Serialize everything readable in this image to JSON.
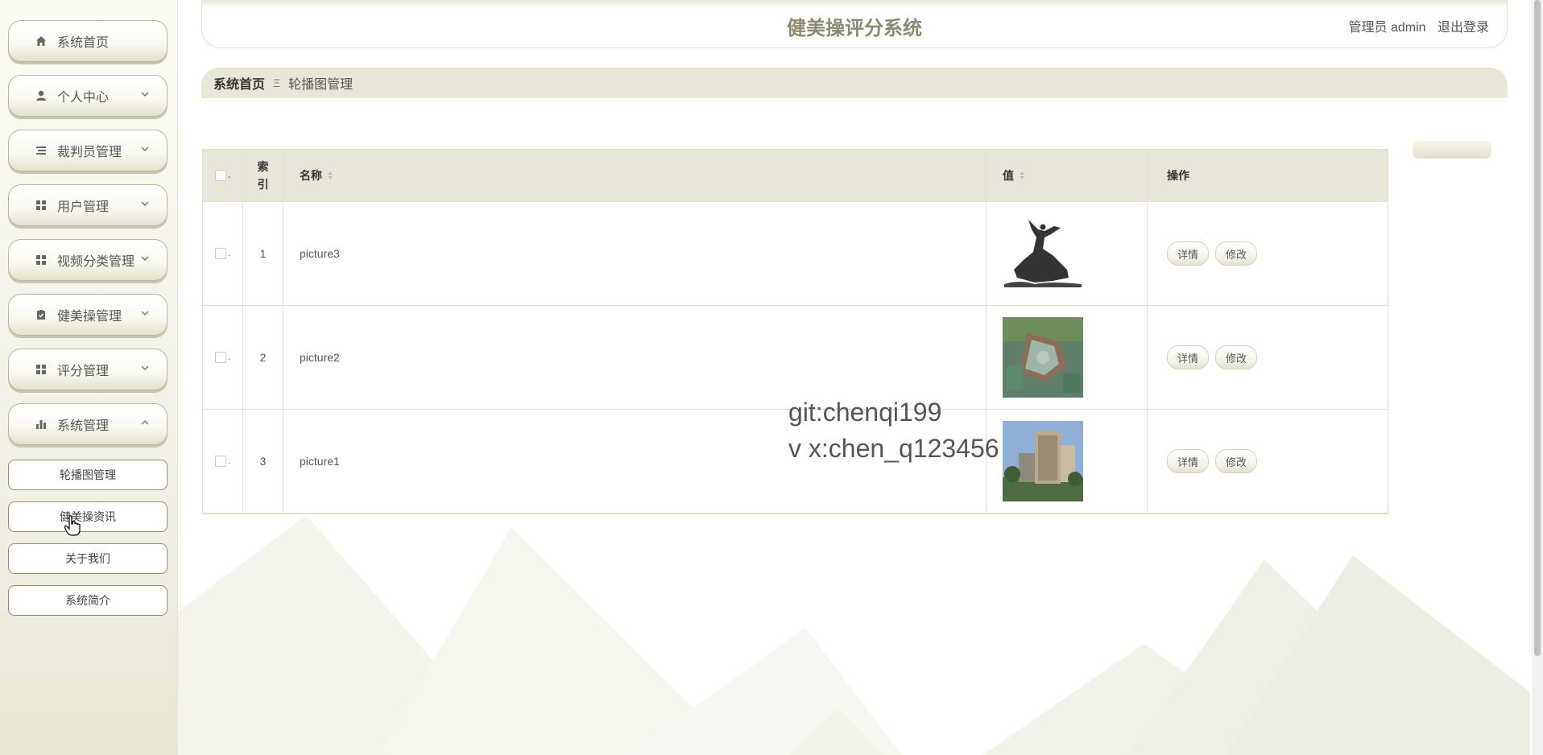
{
  "header": {
    "title": "健美操评分系统",
    "role": "管理员 admin",
    "logout": "退出登录"
  },
  "sidebar": {
    "items": [
      {
        "label": "系统首页",
        "icon": "home-icon"
      },
      {
        "label": "个人中心",
        "icon": "user-icon"
      },
      {
        "label": "裁判员管理",
        "icon": "list-icon"
      },
      {
        "label": "用户管理",
        "icon": "grid-icon"
      },
      {
        "label": "视频分类管理",
        "icon": "grid-icon"
      },
      {
        "label": "健美操管理",
        "icon": "clipboard-check-icon"
      },
      {
        "label": "评分管理",
        "icon": "grid-icon"
      },
      {
        "label": "系统管理",
        "icon": "bar-chart-icon"
      }
    ],
    "sub_items": [
      "轮播图管理",
      "健美操资讯",
      "关于我们",
      "系统简介"
    ]
  },
  "breadcrumb": {
    "home": "系统首页",
    "separator": "Ξ",
    "current": "轮播图管理"
  },
  "table": {
    "headers": {
      "index": "索引",
      "name": "名称",
      "value": "值",
      "ops": "操作"
    },
    "rows": [
      {
        "index": "1",
        "name": "picture3",
        "image": "dancer-silhouette"
      },
      {
        "index": "2",
        "name": "picture2",
        "image": "campus-aerial"
      },
      {
        "index": "3",
        "name": "picture1",
        "image": "building-photo"
      }
    ],
    "detail_label": "详情",
    "edit_label": "修改"
  },
  "watermark": {
    "line1": "git:chenqi199",
    "line2": "v x:chen_q123456"
  },
  "colors": {
    "accent": "#8c8a70",
    "breadcrumb_bg": "#e8e6d5",
    "table_header_bg": "#e8e6d6"
  }
}
